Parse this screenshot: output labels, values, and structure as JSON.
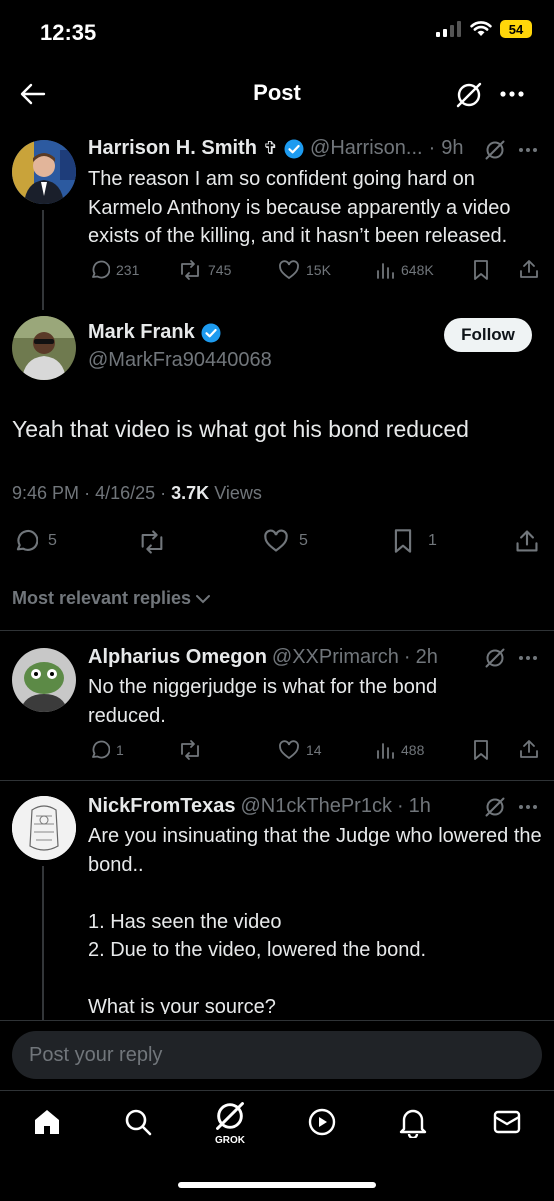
{
  "status_bar": {
    "time": "12:35",
    "battery": "54"
  },
  "header": {
    "title": "Post"
  },
  "parent_tweet": {
    "name": "Harrison H. Smith",
    "name_symbol": "✞",
    "handle": "@Harrison...",
    "time": "9h",
    "text": "The reason I am so confident going hard on Karmelo Anthony is because apparently a video exists of the killing, and it hasn’t been released.",
    "replies": "231",
    "reposts": "745",
    "likes": "15K",
    "views": "648K"
  },
  "main_tweet": {
    "name": "Mark Frank",
    "handle": "@MarkFra90440068",
    "follow_label": "Follow",
    "text": "Yeah that video is what got his bond reduced",
    "time": "9:46 PM",
    "date": "4/16/25",
    "views_count": "3.7K",
    "views_label": "Views",
    "replies": "5",
    "likes": "5",
    "bookmarks": "1"
  },
  "replies_filter": {
    "label": "Most relevant replies"
  },
  "reply1": {
    "name": "Alpharius Omegon",
    "handle": "@XXPrimarch",
    "time": "2h",
    "text": "No the niggerjudge is what for the bond reduced.",
    "replies": "1",
    "likes": "14",
    "views": "488"
  },
  "reply2": {
    "name": "NickFromTexas",
    "handle": "@N1ckThePr1ck",
    "time": "1h",
    "text": "Are you insinuating that the Judge who lowered the bond..\n\n1. Has seen the video\n2. Due to the video, lowered the bond.\n\nWhat is your source?"
  },
  "composer": {
    "placeholder": "Post your reply"
  },
  "tab_bar": {
    "grok_label": "GROK"
  },
  "colors": {
    "accent": "#1d9bf0",
    "background": "#000000",
    "muted": "#71767b",
    "divider": "#2f3336"
  }
}
